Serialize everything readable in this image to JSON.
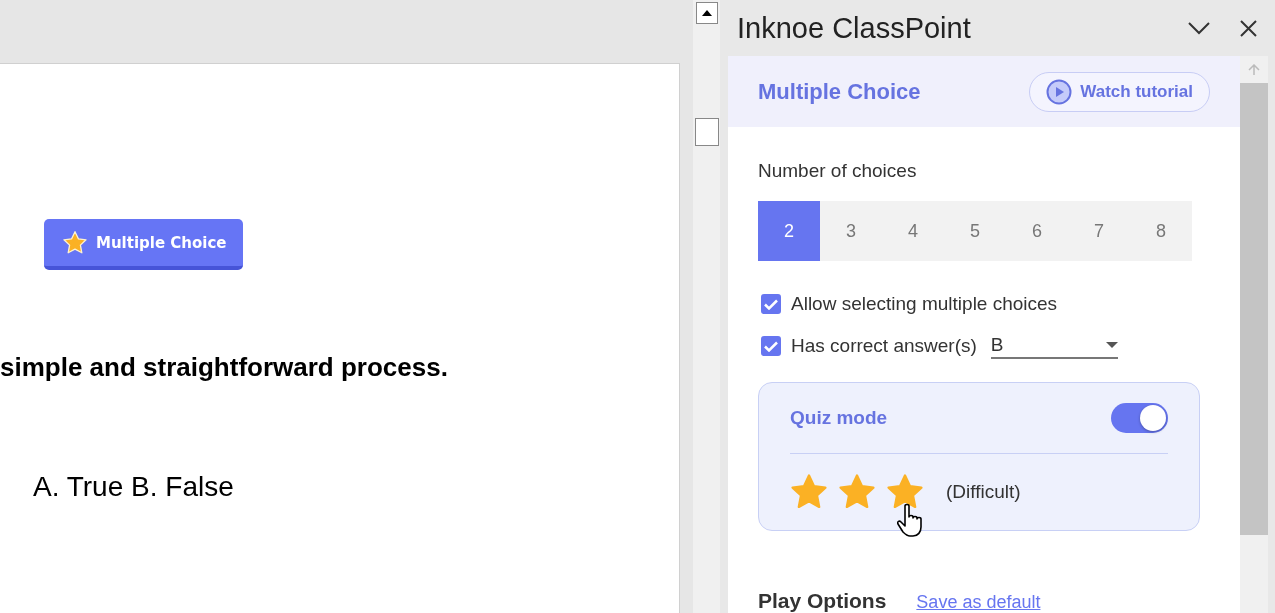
{
  "slide": {
    "badge": "Multiple Choice",
    "question": "simple and straightforward process.",
    "answers": "A. True B. False"
  },
  "panel": {
    "title": "Inknoe ClassPoint",
    "header": {
      "title": "Multiple Choice",
      "tutorial": "Watch tutorial"
    },
    "choices_label": "Number of choices",
    "choices": [
      {
        "label": "2",
        "selected": true
      },
      {
        "label": "3",
        "selected": false
      },
      {
        "label": "4",
        "selected": false
      },
      {
        "label": "5",
        "selected": false
      },
      {
        "label": "6",
        "selected": false
      },
      {
        "label": "7",
        "selected": false
      },
      {
        "label": "8",
        "selected": false
      }
    ],
    "options": [
      {
        "label": "Allow selecting multiple choices",
        "checked": true
      },
      {
        "label": "Has correct answer(s)",
        "checked": true,
        "value": "B"
      }
    ],
    "quiz": {
      "label": "Quiz mode",
      "on": true,
      "stars": 3,
      "difficulty": "(Difficult)"
    },
    "play_options": {
      "title": "Play Options",
      "link": "Save as default"
    }
  }
}
